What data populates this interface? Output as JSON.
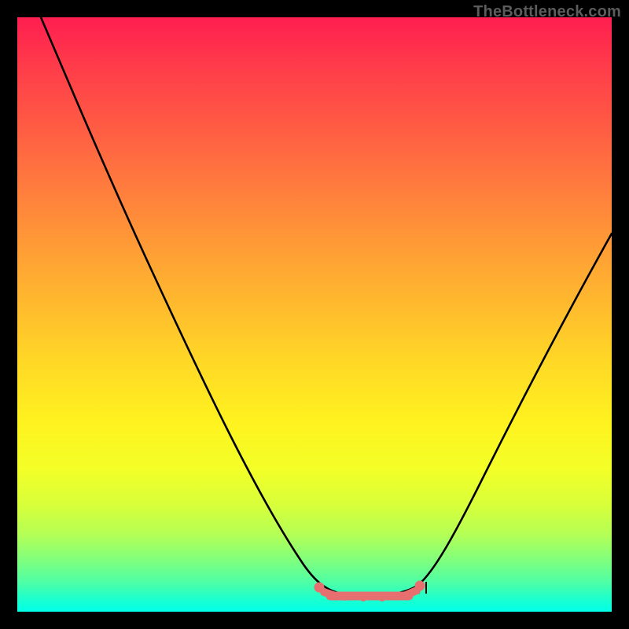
{
  "watermark": {
    "text": "TheBottleneck.com"
  },
  "chart_data": {
    "type": "line",
    "title": "",
    "xlabel": "",
    "ylabel": "",
    "xlim": [
      0,
      100
    ],
    "ylim": [
      0,
      100
    ],
    "grid": false,
    "legend": false,
    "series": [
      {
        "name": "bottleneck-curve",
        "color": "#000000",
        "x": [
          4,
          10,
          20,
          30,
          40,
          48,
          51,
          54,
          57,
          60,
          63,
          66,
          69,
          75,
          82,
          90,
          100
        ],
        "y": [
          100,
          88,
          70,
          52,
          33,
          17,
          10,
          5,
          3,
          3,
          3,
          5,
          10,
          22,
          37,
          52,
          70
        ]
      },
      {
        "name": "optimal-band",
        "color": "#e76f6f",
        "x": [
          51,
          53,
          55,
          57,
          59,
          61,
          63,
          65,
          67,
          69
        ],
        "y": [
          9,
          5,
          4,
          3,
          3,
          3,
          3,
          4,
          5,
          9
        ]
      }
    ],
    "annotations": []
  }
}
